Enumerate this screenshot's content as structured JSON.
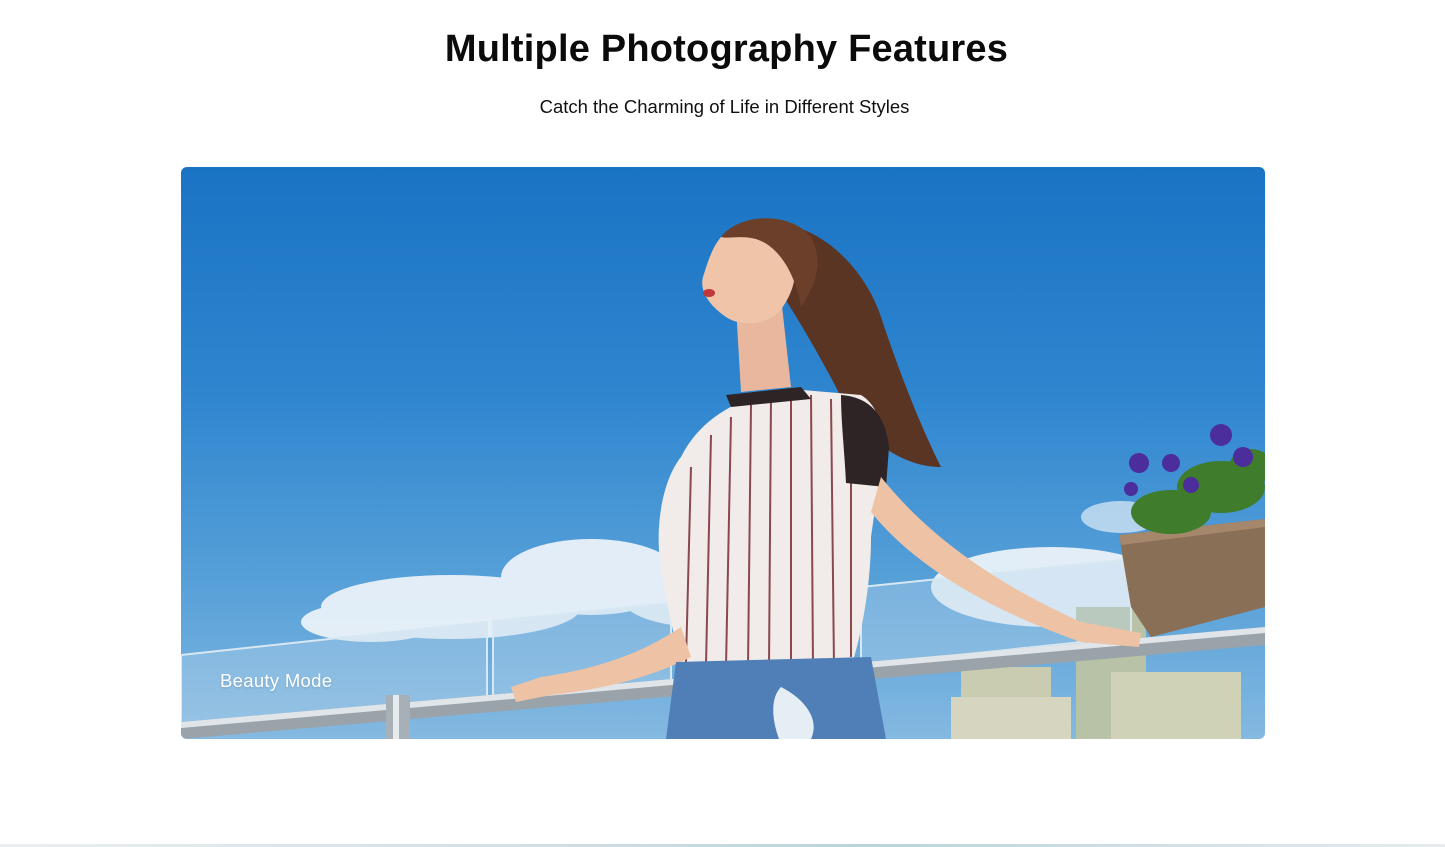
{
  "section": {
    "title": "Multiple Photography Features",
    "subtitle": "Catch the Charming of Life in Different Styles"
  },
  "hero": {
    "mode_label": "Beauty Mode"
  },
  "colors": {
    "sky_top": "#1a73c4",
    "sky_bottom": "#84b9e1",
    "label_text": "#ffffff",
    "heading_text": "#0b0b0b"
  }
}
